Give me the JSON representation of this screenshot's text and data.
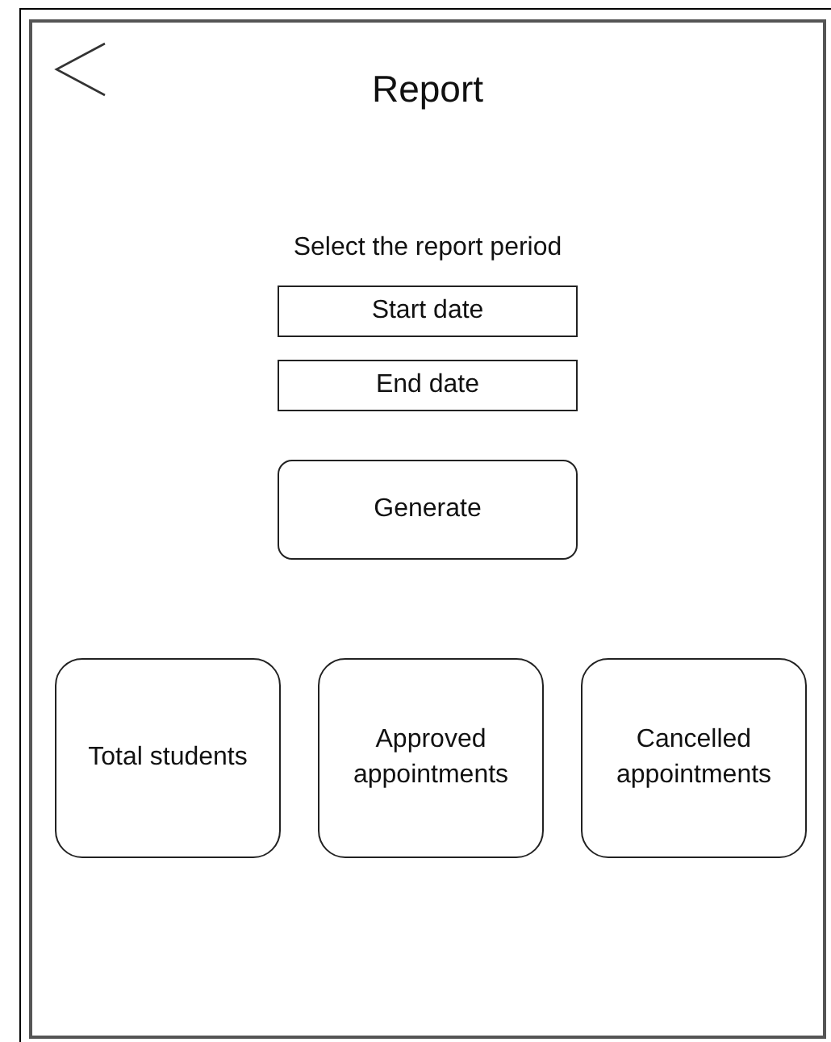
{
  "header": {
    "title": "Report"
  },
  "period": {
    "prompt": "Select the report period",
    "start_field": {
      "placeholder": "Start date"
    },
    "end_field": {
      "placeholder": "End date"
    }
  },
  "generate_button": {
    "label": "Generate"
  },
  "cards": [
    {
      "label": "Total students"
    },
    {
      "label": "Approved appointments"
    },
    {
      "label": "Cancelled appointments"
    }
  ]
}
